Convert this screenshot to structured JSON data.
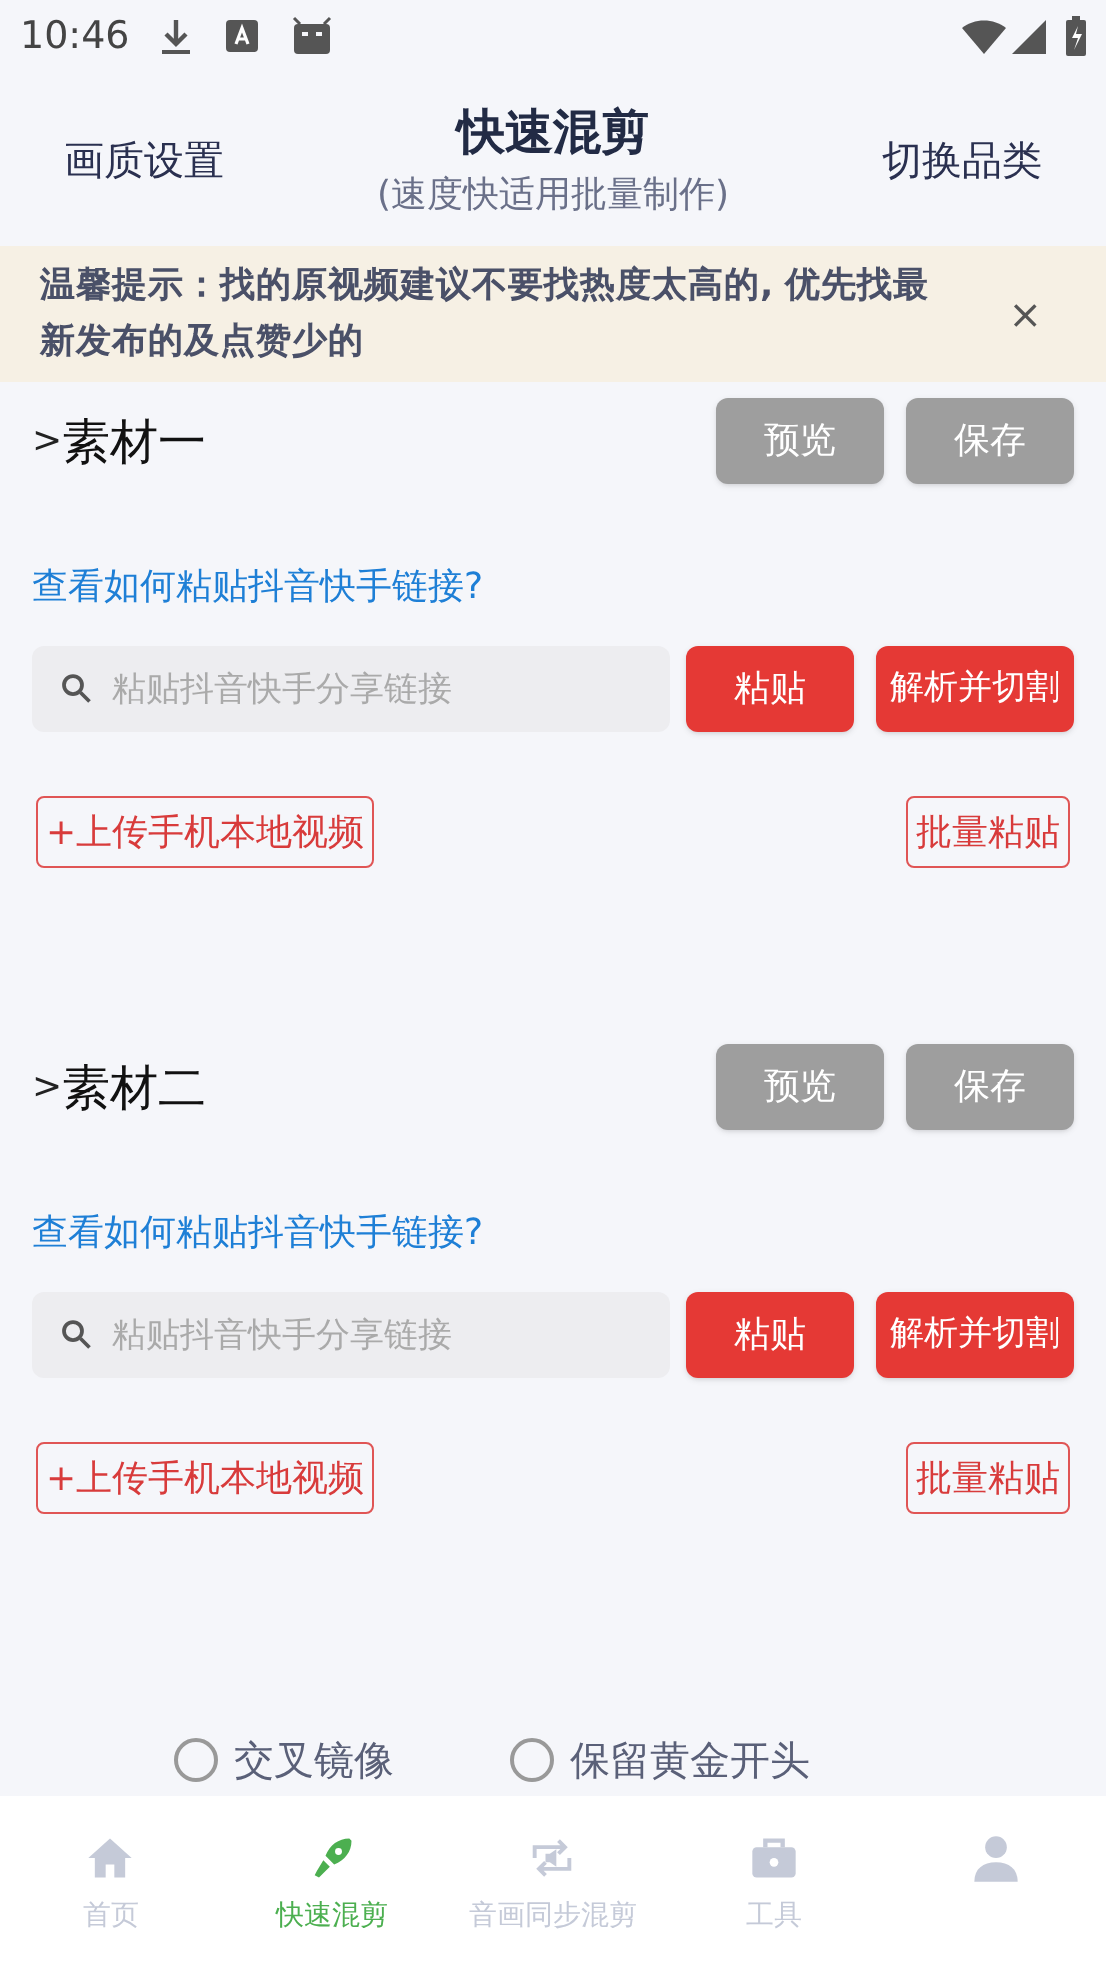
{
  "status_bar": {
    "time": "10:46"
  },
  "header": {
    "left": "画质设置",
    "title": "快速混剪",
    "subtitle": "(速度快适用批量制作)",
    "right": "切换品类"
  },
  "notice": {
    "text": "温馨提示：找的原视频建议不要找热度太高的, 优先找最新发布的及点赞少的",
    "close": "×"
  },
  "sections": [
    {
      "chevron": ">",
      "title": "素材一",
      "preview": "预览",
      "save": "保存",
      "help_link": "查看如何粘贴抖音快手链接?",
      "placeholder": "粘贴抖音快手分享链接",
      "paste": "粘贴",
      "parse": "解析并切割",
      "upload": "+上传手机本地视频",
      "batch": "批量粘贴"
    },
    {
      "chevron": ">",
      "title": "素材二",
      "preview": "预览",
      "save": "保存",
      "help_link": "查看如何粘贴抖音快手链接?",
      "placeholder": "粘贴抖音快手分享链接",
      "paste": "粘贴",
      "parse": "解析并切割",
      "upload": "+上传手机本地视频",
      "batch": "批量粘贴"
    }
  ],
  "options": [
    {
      "label": "交叉镜像",
      "checked": false
    },
    {
      "label": "保留黄金开头",
      "checked": false
    }
  ],
  "tabs": [
    {
      "kind": "home",
      "label": "首页",
      "selected": false
    },
    {
      "kind": "rocket",
      "label": "快速混剪",
      "selected": true
    },
    {
      "kind": "sync",
      "label": "音画同步混剪",
      "selected": false
    },
    {
      "kind": "toolbox",
      "label": "工具",
      "selected": false
    },
    {
      "kind": "person",
      "selected": false
    }
  ]
}
